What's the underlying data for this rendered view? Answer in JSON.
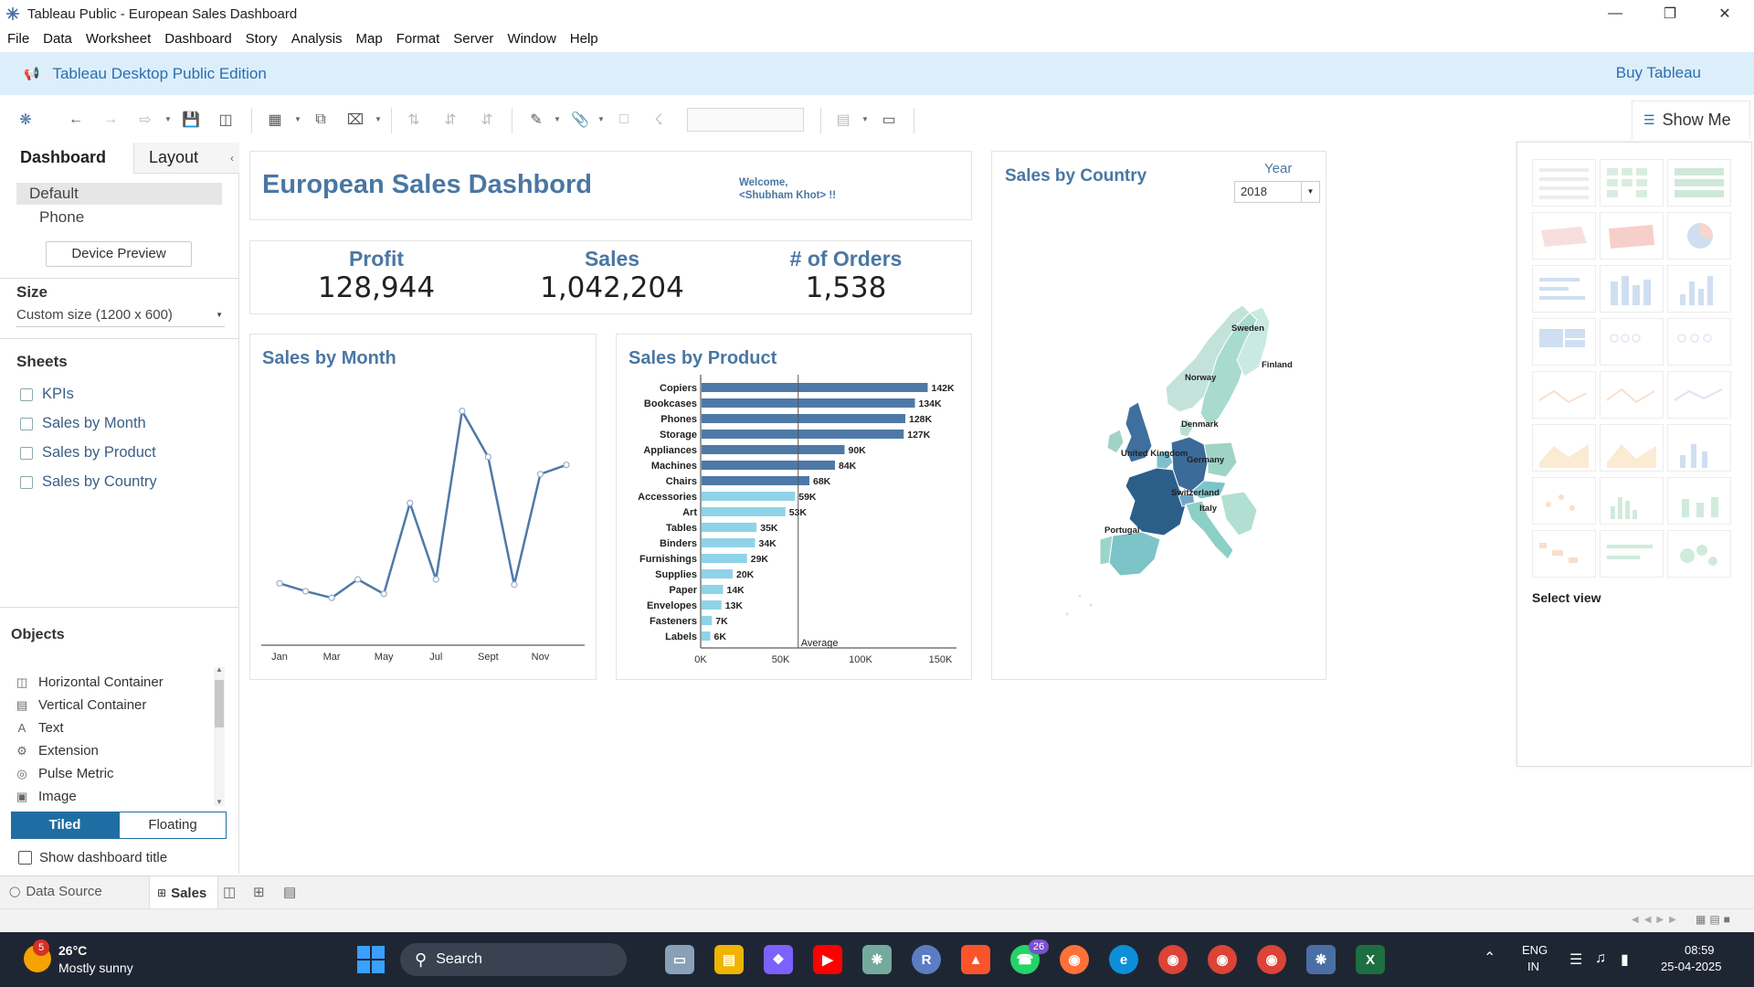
{
  "window": {
    "title": "Tableau Public - European Sales Dashboard"
  },
  "menu": [
    "File",
    "Data",
    "Worksheet",
    "Dashboard",
    "Story",
    "Analysis",
    "Map",
    "Format",
    "Server",
    "Window",
    "Help"
  ],
  "banner": {
    "edition": "Tableau Desktop Public Edition",
    "buy": "Buy Tableau"
  },
  "toolbar": {
    "show_me": "Show Me"
  },
  "left": {
    "tabs": {
      "dashboard": "Dashboard",
      "layout": "Layout"
    },
    "devices": {
      "default": "Default",
      "phone": "Phone",
      "preview": "Device Preview"
    },
    "size": {
      "title": "Size",
      "value": "Custom size (1200 x 600)"
    },
    "sheets": {
      "title": "Sheets",
      "items": [
        "KPIs",
        "Sales by Month",
        "Sales by Product",
        "Sales by Country"
      ]
    },
    "objects": {
      "title": "Objects",
      "items": [
        "Horizontal Container",
        "Vertical Container",
        "Text",
        "Extension",
        "Pulse Metric",
        "Image"
      ],
      "tiled": "Tiled",
      "floating": "Floating",
      "show_title": "Show dashboard title"
    }
  },
  "dashboard": {
    "title": "European Sales Dashbord",
    "welcome_line1": "Welcome,",
    "welcome_line2": "<Shubham Khot> !!",
    "kpis": [
      {
        "label": "Profit",
        "value": "128,944"
      },
      {
        "label": "Sales",
        "value": "1,042,204"
      },
      {
        "label": "# of Orders",
        "value": "1,538"
      }
    ],
    "month_title": "Sales by Month",
    "product_title": "Sales by Product",
    "country_title": "Sales by Country",
    "year_label": "Year",
    "year_value": "2018",
    "country_labels": [
      "Sweden",
      "Finland",
      "Norway",
      "Denmark",
      "United Kingdom",
      "Germany",
      "Switzerland",
      "Italy",
      "Portugal"
    ]
  },
  "chart_data": [
    {
      "type": "line",
      "title": "Sales by Month",
      "x": [
        "Jan",
        "Feb",
        "Mar",
        "Apr",
        "May",
        "Jun",
        "Jul",
        "Aug",
        "Sept",
        "Oct",
        "Nov",
        "Dec"
      ],
      "x_tick_labels": [
        "Jan",
        "Mar",
        "May",
        "Jul",
        "Sept",
        "Nov"
      ],
      "values": [
        47000,
        41000,
        36000,
        50000,
        39000,
        108000,
        50000,
        178000,
        143000,
        46000,
        130000,
        137000
      ],
      "ylim": [
        0,
        200000
      ],
      "color": "#4e79a7"
    },
    {
      "type": "bar",
      "title": "Sales by Product",
      "categories": [
        "Copiers",
        "Bookcases",
        "Phones",
        "Storage",
        "Appliances",
        "Machines",
        "Chairs",
        "Accessories",
        "Art",
        "Tables",
        "Binders",
        "Furnishings",
        "Supplies",
        "Paper",
        "Envelopes",
        "Fasteners",
        "Labels"
      ],
      "values": [
        142,
        134,
        128,
        127,
        90,
        84,
        68,
        59,
        53,
        35,
        34,
        29,
        20,
        14,
        13,
        7,
        6
      ],
      "data_labels": [
        "142K",
        "134K",
        "128K",
        "127K",
        "90K",
        "84K",
        "68K",
        "59K",
        "53K",
        "35K",
        "34K",
        "29K",
        "20K",
        "14K",
        "13K",
        "7K",
        "6K"
      ],
      "xticks": [
        "0K",
        "50K",
        "100K",
        "150K"
      ],
      "xlim": [
        0,
        160
      ],
      "reference_line": {
        "label": "Average",
        "value": 61
      },
      "colors": {
        "above_average": "#4e79a7",
        "below_average": "#8fd3e8"
      }
    }
  ],
  "bottom": {
    "data_source": "Data Source",
    "sheet_tab": "Sales"
  },
  "showme": {
    "select": "Select view"
  },
  "taskbar": {
    "weather_temp": "26°C",
    "weather_desc": "Mostly sunny",
    "weather_badge": "5",
    "search": "Search",
    "lang1": "ENG",
    "lang2": "IN",
    "time": "08:59",
    "date": "25-04-2025",
    "whatsapp_badge": "26"
  }
}
